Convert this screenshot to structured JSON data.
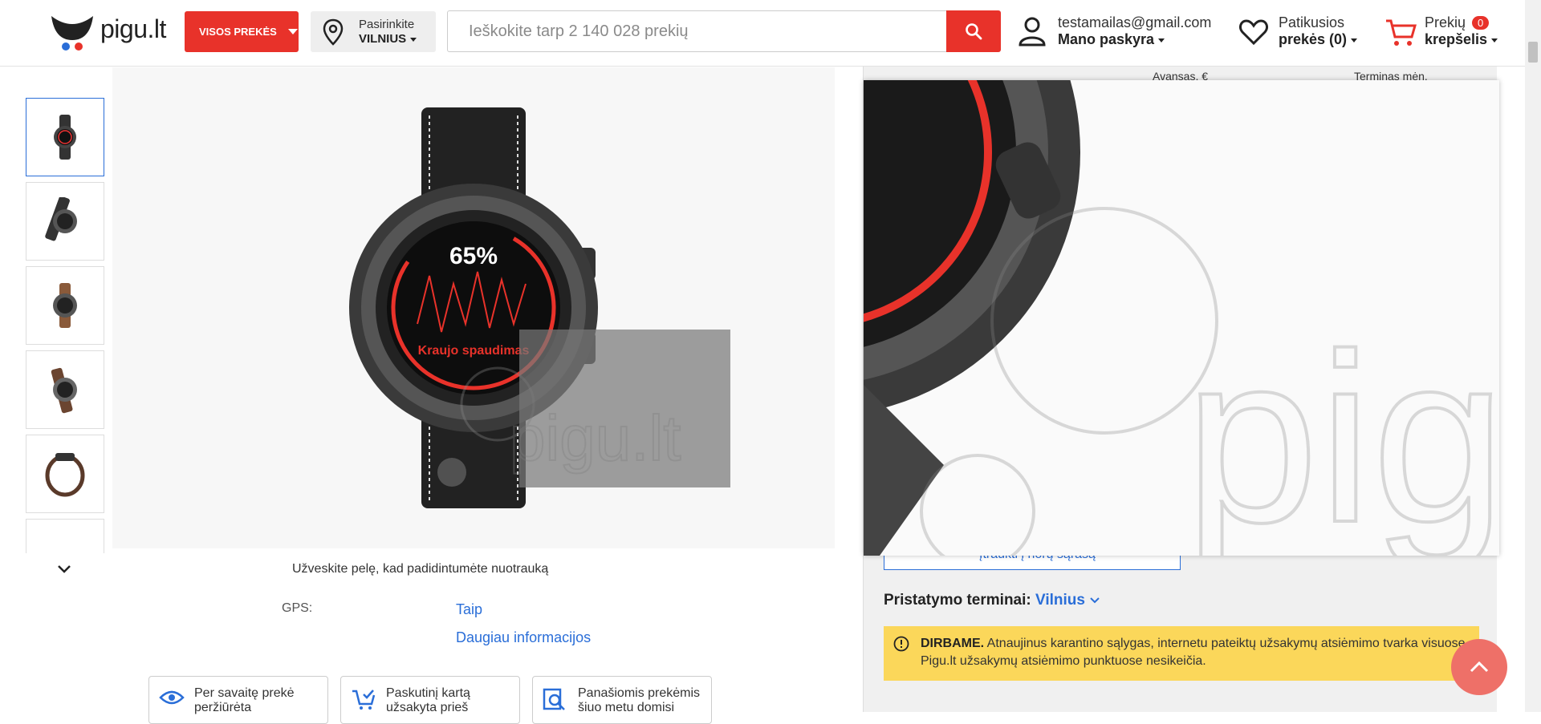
{
  "header": {
    "logo_text": "pigu.lt",
    "all_products_label": "VISOS PREKĖS",
    "location": {
      "line1": "Pasirinkite",
      "line2": "VILNIUS"
    },
    "search_placeholder": "Ieškokite tarp 2 140 028 prekių",
    "account": {
      "email": "testamailas@gmail.com",
      "label": "Mano paskyra"
    },
    "favorites": {
      "line1": "Patikusios",
      "line2": "prekės (0)"
    },
    "cart": {
      "line1": "Prekių",
      "line2": "krepšelis",
      "count": "0"
    }
  },
  "gallery": {
    "thumbnails": [
      "thumb-1",
      "thumb-2",
      "thumb-3",
      "thumb-4",
      "thumb-5",
      "thumb-6"
    ],
    "watch_face": {
      "percent": "65%",
      "label": "Kraujo spaudimas"
    },
    "watermark": "pigu.lt",
    "hover_hint": "Užveskite pelę, kad padidintumėte nuotrauką"
  },
  "specs": {
    "gps_label": "GPS:",
    "gps_value": "Taip",
    "more_info": "Daugiau informacijos"
  },
  "stats": [
    {
      "icon": "eye-icon",
      "text": "Per savaitę prekė peržiūrėta"
    },
    {
      "icon": "cart-check-icon",
      "text": "Paskutinį kartą užsakyta prieš"
    },
    {
      "icon": "search-doc-icon",
      "text": "Panašiomis prekėmis šiuo metu domisi"
    }
  ],
  "right_panel": {
    "col_advance": "Avansas, €",
    "col_term": "Terminas mėn.",
    "wishlist_button": "Įtraukti į norų sąrašą",
    "delivery_label": "Pristatymo terminai:",
    "delivery_city": "Vilnius",
    "notice_bold": "DIRBAME.",
    "notice_text": "Atnaujinus karantino sąlygas, internetu pateiktų užsakymų atsiėmimo tvarka visuose Pigu.lt užsakymų atsiėmimo punktuose nesikeičia."
  },
  "colors": {
    "accent": "#e8322a",
    "link": "#2a6ed8",
    "notice": "#fbd75a"
  }
}
